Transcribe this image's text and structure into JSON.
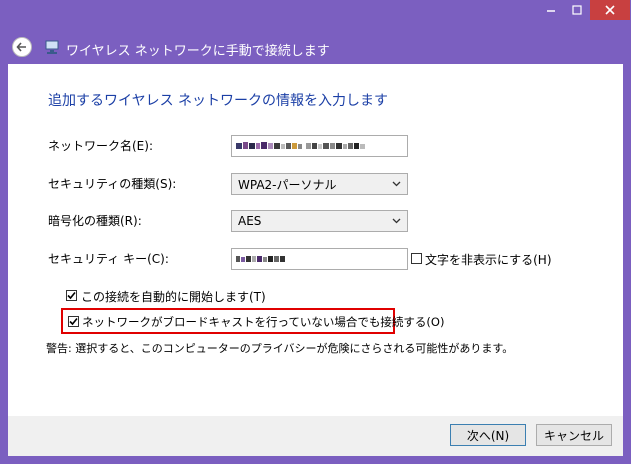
{
  "window": {
    "title": "ワイヤレス ネットワークに手動で接続します",
    "controls": {
      "minimize": "–",
      "maximize": "□",
      "close": "✕"
    }
  },
  "instruction": "追加するワイヤレス ネットワークの情報を入力します",
  "form": {
    "network_name_label": "ネットワーク名(E):",
    "security_type_label": "セキュリティの種類(S):",
    "security_type_value": "WPA2-パーソナル",
    "encryption_type_label": "暗号化の種類(R):",
    "encryption_type_value": "AES",
    "security_key_label": "セキュリティ キー(C):",
    "hide_chars_label": "文字を非表示にする(H)",
    "auto_connect_label": "この接続を自動的に開始します(T)",
    "auto_connect_checked": true,
    "connect_hidden_label": "ネットワークがブロードキャストを行っていない場合でも接続する(O)",
    "connect_hidden_checked": true,
    "hide_chars_checked": false
  },
  "warning": "警告: 選択すると、このコンピューターのプライバシーが危険にさらされる可能性があります。",
  "buttons": {
    "next": "次へ(N)",
    "cancel": "キャンセル"
  }
}
